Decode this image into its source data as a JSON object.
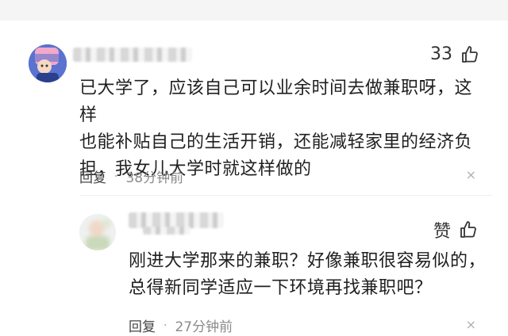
{
  "comment": {
    "likes": "33",
    "lines": [
      "已大学了，应该自己可以业余时间去做兼职呀，这样",
      "也能补贴自己的生活开销，还能减轻家里的经济负",
      "担，我女儿大学时就这样做的"
    ],
    "reply_label": "回复",
    "separator": "·",
    "time": "38分钟前",
    "close_glyph": "×"
  },
  "reply": {
    "like_label": "赞",
    "lines": [
      "刚进大学那来的兼职？好像兼职很容易似的，",
      "总得新同学适应一下环境再找兼职吧？"
    ],
    "reply_label": "回复",
    "separator": "·",
    "time": "27分钟前",
    "close_glyph": "×"
  },
  "icons": {
    "like": "thumbs-up-icon",
    "close": "close-icon",
    "avatar1": "cartoon-avatar",
    "avatar2": "blurred-avatar"
  },
  "colors": {
    "text": "#1f1f1f",
    "meta": "#8a8a8a",
    "avatar1_bg": "#4e67c4"
  }
}
